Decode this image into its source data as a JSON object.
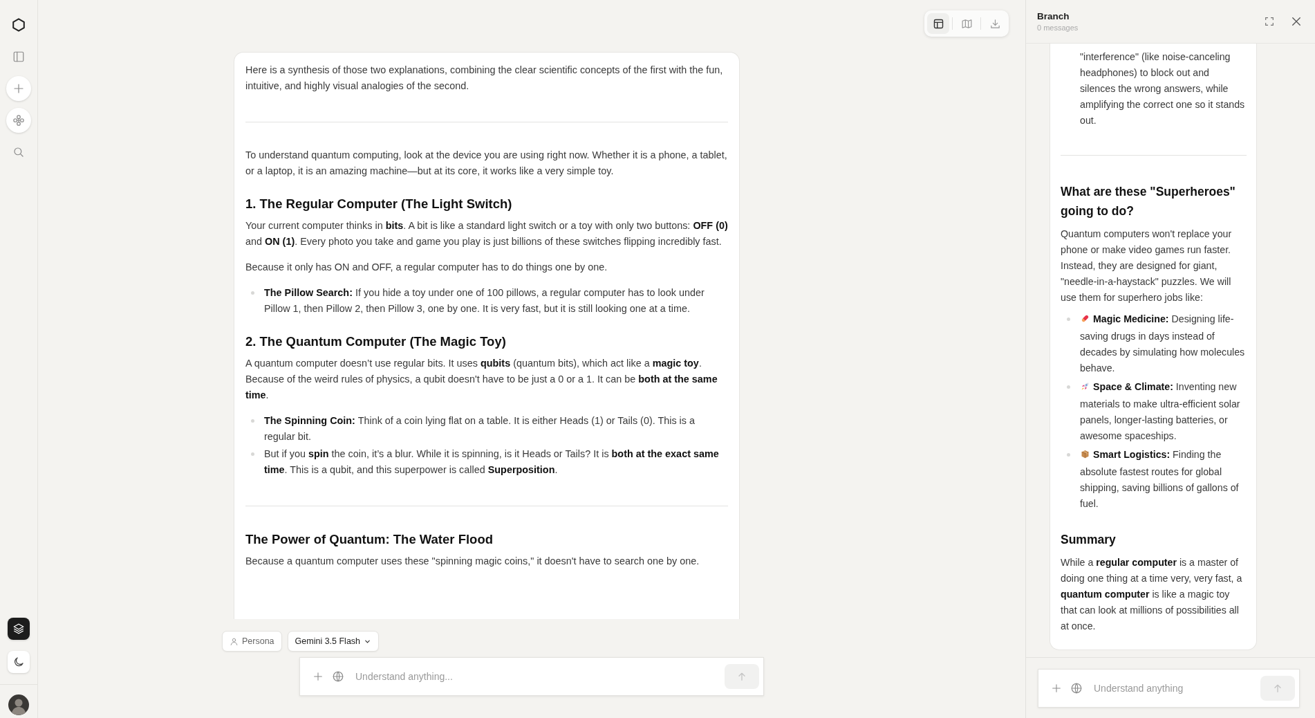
{
  "sidebar": {
    "items": [
      {
        "kind": "logo"
      },
      {
        "kind": "panel"
      },
      {
        "kind": "new"
      },
      {
        "kind": "flower"
      },
      {
        "kind": "search"
      }
    ],
    "bottom_items": [
      {
        "kind": "layers",
        "selected": true
      },
      {
        "kind": "moon",
        "selected": false
      },
      {
        "kind": "avatar"
      }
    ]
  },
  "toolbar": {
    "items": [
      {
        "kind": "layout",
        "selected": true
      },
      {
        "kind": "map",
        "selected": false
      },
      {
        "kind": "download",
        "selected": false
      }
    ]
  },
  "main": {
    "blocks": [
      {
        "kind": "paragraph",
        "text": "Here is a synthesis of those two explanations, combining the clear scientific concepts of the first with the fun, intuitive, and highly visual analogies of the second."
      },
      {
        "kind": "divider"
      },
      {
        "kind": "paragraph",
        "text": "To understand quantum computing, look at the device you are using right now. Whether it is a phone, a tablet, or a laptop, it is an amazing machine—but at its core, it works like a very simple toy."
      },
      {
        "kind": "heading",
        "text": "1. The Regular Computer (The Light Switch)"
      },
      {
        "kind": "paragraph",
        "text": "Your current computer thinks in **bits**. A bit is like a standard light switch or a toy with only two buttons: **OFF (0)** and **ON (1)**. Every photo you take and game you play is just billions of these switches flipping incredibly fast."
      },
      {
        "kind": "paragraph",
        "text": "Because it only has ON and OFF, a regular computer has to do things one by one."
      },
      {
        "kind": "bullets",
        "items": [
          "**The Pillow Search:** If you hide a toy under one of 100 pillows, a regular computer has to look under Pillow 1, then Pillow 2, then Pillow 3, one by one. It is very fast, but it is still looking one at a time."
        ]
      },
      {
        "kind": "heading",
        "text": "2. The Quantum Computer (The Magic Toy)"
      },
      {
        "kind": "paragraph",
        "text": "A quantum computer doesn’t use regular bits. It uses **qubits** (quantum bits), which act like a **magic toy**. Because of the weird rules of physics, a qubit doesn't have to be just a 0 or a 1. It can be **both at the same time**."
      },
      {
        "kind": "bullets",
        "items": [
          "**The Spinning Coin:** Think of a coin lying flat on a table. It is either Heads (1) or Tails (0). This is a regular bit.",
          "But if you **spin** the coin, it’s a blur. While it is spinning, is it Heads or Tails? It is **both at the exact same time**. This is a qubit, and this superpower is called **Superposition**."
        ]
      },
      {
        "kind": "divider"
      },
      {
        "kind": "heading",
        "text": "The Power of Quantum: The Water Flood"
      },
      {
        "kind": "paragraph",
        "text": "Because a quantum computer uses these \"spinning magic coins,\" it doesn't have to search one by one."
      }
    ]
  },
  "composer": {
    "persona": "Persona",
    "model": "Gemini 3.5 Flash",
    "placeholder": "Understand anything..."
  },
  "branch": {
    "title": "Branch",
    "subtitle": "0 messages",
    "blocks": [
      {
        "kind": "continuation",
        "text": "\"interference\" (like noise-canceling headphones) to block out and silences the wrong answers, while amplifying the correct one so it stands out."
      },
      {
        "kind": "divider"
      },
      {
        "kind": "heading",
        "text": "What are these \"Superheroes\" going to do?"
      },
      {
        "kind": "paragraph",
        "text": "Quantum computers won't replace your phone or make video games run faster. Instead, they are designed for giant, \"needle-in-a-haystack\" puzzles. We will use them for superhero jobs like:"
      },
      {
        "kind": "bullets",
        "items": [
          {
            "text": "**Magic Medicine:** Designing life-saving drugs in days instead of decades by simulating how molecules behave."
          },
          {
            "text": "**Space & Climate:** Inventing new materials to make ultra-efficient solar panels, longer-lasting batteries, or awesome spaceships."
          },
          {
            "text": "**Smart Logistics:** Finding the absolute fastest routes for global shipping, saving billions of gallons of fuel."
          }
        ]
      },
      {
        "kind": "heading",
        "text": "Summary"
      },
      {
        "kind": "paragraph",
        "text": "While a **regular computer** is a master of doing one thing at a time very, very fast, a **quantum computer** is like a magic toy that can look at millions of possibilities all at once."
      }
    ],
    "placeholder": "Understand anything"
  }
}
